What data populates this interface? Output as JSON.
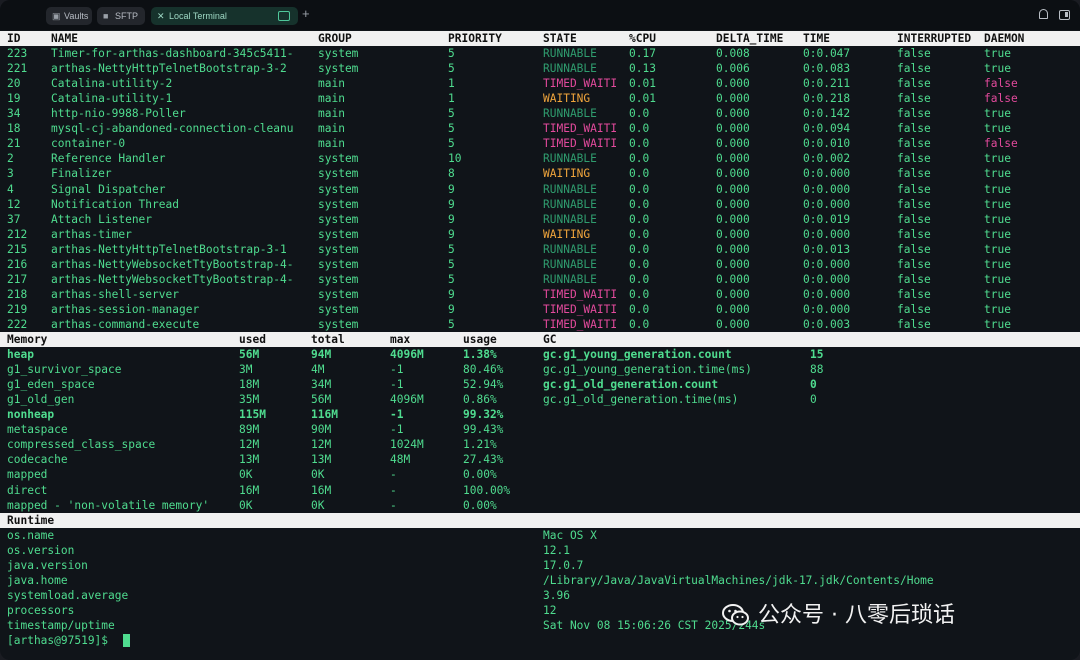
{
  "tabs": [
    {
      "label": "Vaults",
      "icon": "vault-icon"
    },
    {
      "label": "SFTP",
      "icon": "folder-icon"
    },
    {
      "label": "Local Terminal",
      "icon": "terminal-icon"
    }
  ],
  "threads": {
    "headers": [
      "ID",
      "NAME",
      "GROUP",
      "PRIORITY",
      "STATE",
      "%CPU",
      "DELTA_TIME",
      "TIME",
      "INTERRUPTED",
      "DAEMON"
    ],
    "rows": [
      [
        "223",
        "Timer-for-arthas-dashboard-345c5411-",
        "system",
        "5",
        "RUNNABLE",
        "0.17",
        "0.008",
        "0:0.047",
        "false",
        "true"
      ],
      [
        "221",
        "arthas-NettyHttpTelnetBootstrap-3-2",
        "system",
        "5",
        "RUNNABLE",
        "0.13",
        "0.006",
        "0:0.083",
        "false",
        "true"
      ],
      [
        "20",
        "Catalina-utility-2",
        "main",
        "1",
        "TIMED_WAITI",
        "0.01",
        "0.000",
        "0:0.211",
        "false",
        "false"
      ],
      [
        "19",
        "Catalina-utility-1",
        "main",
        "1",
        "WAITING",
        "0.01",
        "0.000",
        "0:0.218",
        "false",
        "false"
      ],
      [
        "34",
        "http-nio-9988-Poller",
        "main",
        "5",
        "RUNNABLE",
        "0.0",
        "0.000",
        "0:0.142",
        "false",
        "true"
      ],
      [
        "18",
        "mysql-cj-abandoned-connection-cleanu",
        "main",
        "5",
        "TIMED_WAITI",
        "0.0",
        "0.000",
        "0:0.094",
        "false",
        "true"
      ],
      [
        "21",
        "container-0",
        "main",
        "5",
        "TIMED_WAITI",
        "0.0",
        "0.000",
        "0:0.010",
        "false",
        "false"
      ],
      [
        "2",
        "Reference Handler",
        "system",
        "10",
        "RUNNABLE",
        "0.0",
        "0.000",
        "0:0.002",
        "false",
        "true"
      ],
      [
        "3",
        "Finalizer",
        "system",
        "8",
        "WAITING",
        "0.0",
        "0.000",
        "0:0.000",
        "false",
        "true"
      ],
      [
        "4",
        "Signal Dispatcher",
        "system",
        "9",
        "RUNNABLE",
        "0.0",
        "0.000",
        "0:0.000",
        "false",
        "true"
      ],
      [
        "12",
        "Notification Thread",
        "system",
        "9",
        "RUNNABLE",
        "0.0",
        "0.000",
        "0:0.000",
        "false",
        "true"
      ],
      [
        "37",
        "Attach Listener",
        "system",
        "9",
        "RUNNABLE",
        "0.0",
        "0.000",
        "0:0.019",
        "false",
        "true"
      ],
      [
        "212",
        "arthas-timer",
        "system",
        "9",
        "WAITING",
        "0.0",
        "0.000",
        "0:0.000",
        "false",
        "true"
      ],
      [
        "215",
        "arthas-NettyHttpTelnetBootstrap-3-1",
        "system",
        "5",
        "RUNNABLE",
        "0.0",
        "0.000",
        "0:0.013",
        "false",
        "true"
      ],
      [
        "216",
        "arthas-NettyWebsocketTtyBootstrap-4-",
        "system",
        "5",
        "RUNNABLE",
        "0.0",
        "0.000",
        "0:0.000",
        "false",
        "true"
      ],
      [
        "217",
        "arthas-NettyWebsocketTtyBootstrap-4-",
        "system",
        "5",
        "RUNNABLE",
        "0.0",
        "0.000",
        "0:0.000",
        "false",
        "true"
      ],
      [
        "218",
        "arthas-shell-server",
        "system",
        "9",
        "TIMED_WAITI",
        "0.0",
        "0.000",
        "0:0.000",
        "false",
        "true"
      ],
      [
        "219",
        "arthas-session-manager",
        "system",
        "9",
        "TIMED_WAITI",
        "0.0",
        "0.000",
        "0:0.000",
        "false",
        "true"
      ],
      [
        "222",
        "arthas-command-execute",
        "system",
        "5",
        "TIMED_WAITI",
        "0.0",
        "0.000",
        "0:0.003",
        "false",
        "true"
      ]
    ]
  },
  "memory": {
    "headers": [
      "Memory",
      "used",
      "total",
      "max",
      "usage",
      "GC"
    ],
    "rows": [
      {
        "cells": [
          "heap",
          "56M",
          "94M",
          "4096M",
          "1.38%"
        ],
        "bold": true
      },
      {
        "cells": [
          "g1_survivor_space",
          "3M",
          "4M",
          "-1",
          "80.46%"
        ],
        "bold": false
      },
      {
        "cells": [
          "g1_eden_space",
          "18M",
          "34M",
          "-1",
          "52.94%"
        ],
        "bold": false
      },
      {
        "cells": [
          "g1_old_gen",
          "35M",
          "56M",
          "4096M",
          "0.86%"
        ],
        "bold": false
      },
      {
        "cells": [
          "nonheap",
          "115M",
          "116M",
          "-1",
          "99.32%"
        ],
        "bold": true
      },
      {
        "cells": [
          "metaspace",
          "89M",
          "90M",
          "-1",
          "99.43%"
        ],
        "bold": false
      },
      {
        "cells": [
          "compressed_class_space",
          "12M",
          "12M",
          "1024M",
          "1.21%"
        ],
        "bold": false
      },
      {
        "cells": [
          "codecache",
          "13M",
          "13M",
          "48M",
          "27.43%"
        ],
        "bold": false
      },
      {
        "cells": [
          "mapped",
          "0K",
          "0K",
          "-",
          "0.00%"
        ],
        "bold": false
      },
      {
        "cells": [
          "direct",
          "16M",
          "16M",
          "-",
          "100.00%"
        ],
        "bold": false
      },
      {
        "cells": [
          "mapped - 'non-volatile memory'",
          "0K",
          "0K",
          "-",
          "0.00%"
        ],
        "bold": false
      }
    ],
    "gc": [
      {
        "name": "gc.g1_young_generation.count",
        "value": "15",
        "bold": true
      },
      {
        "name": "gc.g1_young_generation.time(ms)",
        "value": "88",
        "bold": false
      },
      {
        "name": "gc.g1_old_generation.count",
        "value": "0",
        "bold": true
      },
      {
        "name": "gc.g1_old_generation.time(ms)",
        "value": "0",
        "bold": false
      }
    ]
  },
  "runtime": {
    "header": "Runtime",
    "rows": [
      [
        "os.name",
        "Mac OS X"
      ],
      [
        "os.version",
        "12.1"
      ],
      [
        "java.version",
        "17.0.7"
      ],
      [
        "java.home",
        "/Library/Java/JavaVirtualMachines/jdk-17.jdk/Contents/Home"
      ],
      [
        "systemload.average",
        "3.96"
      ],
      [
        "processors",
        "12"
      ],
      [
        "timestamp/uptime",
        "Sat Nov 08 15:06:26 CST 2025/244s"
      ]
    ]
  },
  "prompt": "[arthas@97519]$ ",
  "watermark": "公众号 · 八零后琐话",
  "colors": {
    "green": "#4fdc8f",
    "runnable": "#2f9c6e",
    "waiting": "#f0a53c",
    "timed_waiting": "#e24a9c",
    "header_bg": "#f1f1f1",
    "background": "#101419"
  }
}
